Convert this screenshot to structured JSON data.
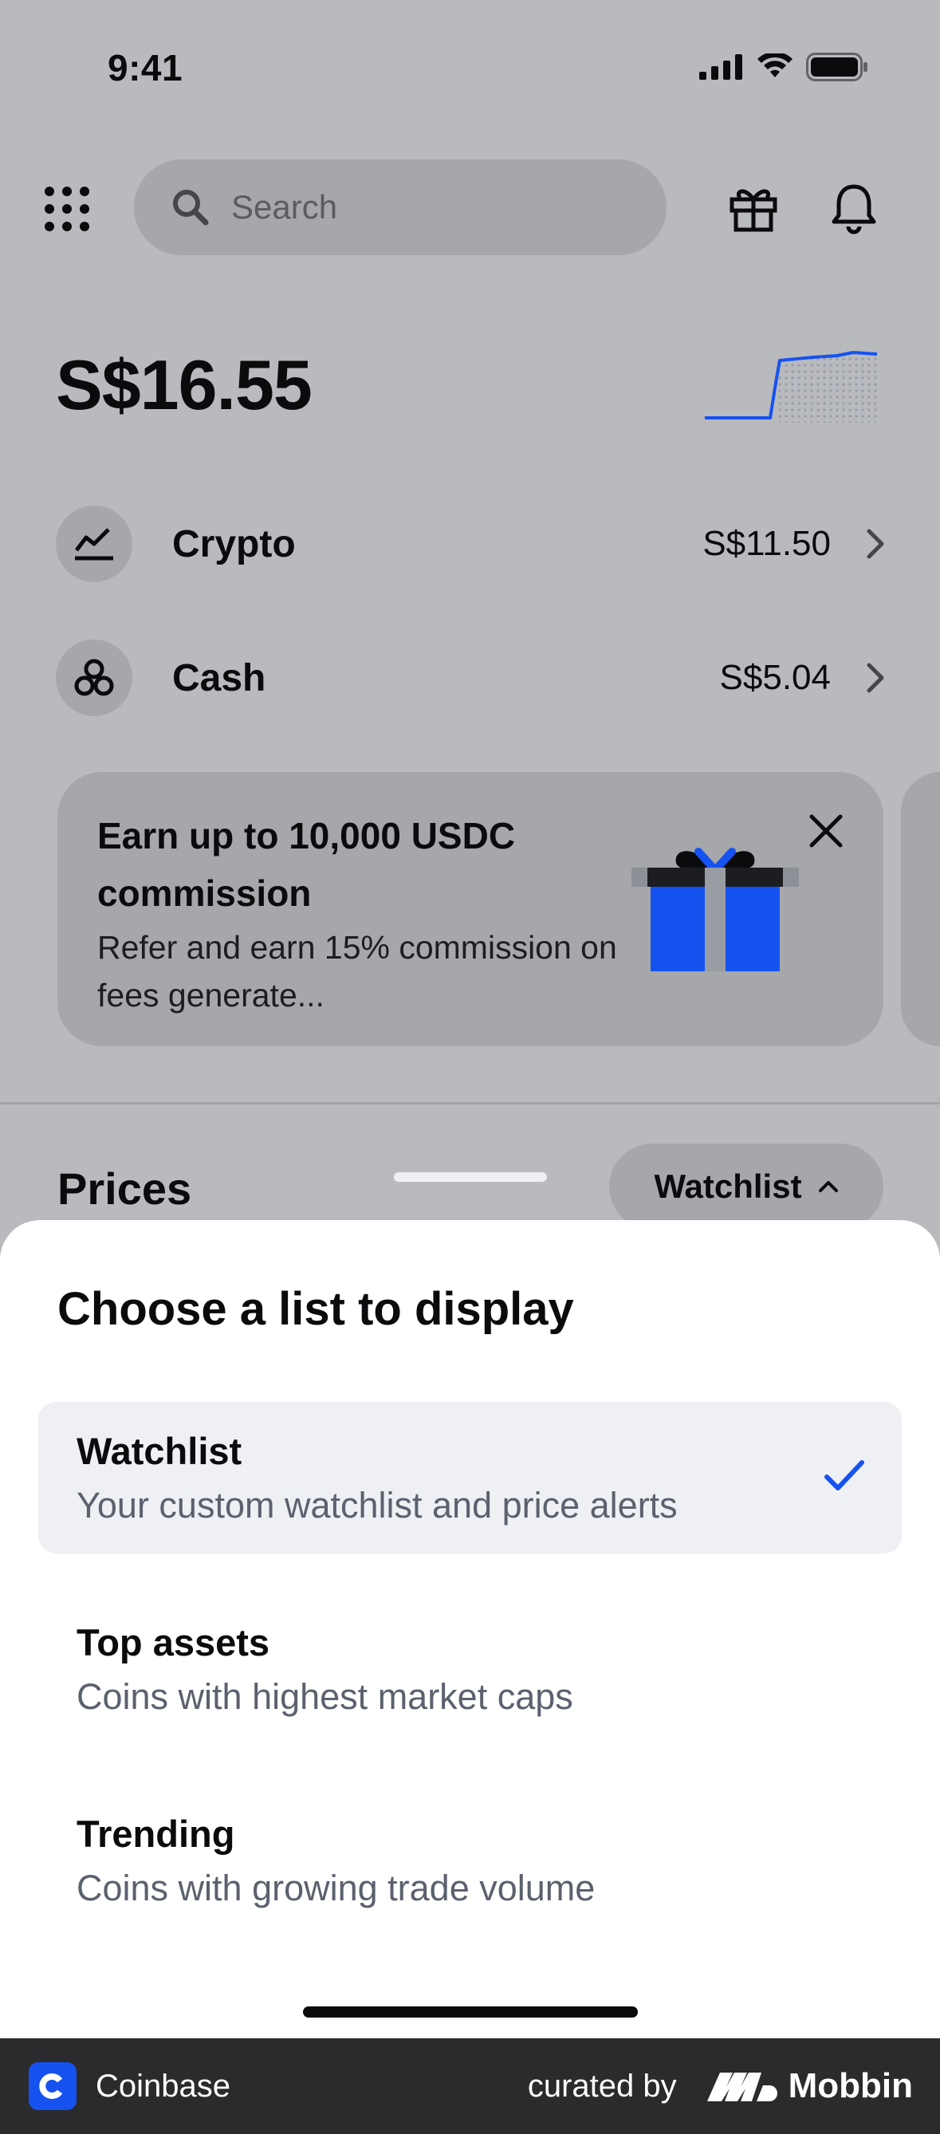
{
  "status_bar": {
    "time": "9:41"
  },
  "header": {
    "search_placeholder": "Search"
  },
  "portfolio": {
    "total": "S$16.55",
    "rows": [
      {
        "label": "Crypto",
        "value": "S$11.50"
      },
      {
        "label": "Cash",
        "value": "S$5.04"
      }
    ]
  },
  "promo": {
    "title": "Earn up to 10,000 USDC commission",
    "body": "Refer and earn 15% commission on fees generate..."
  },
  "prices": {
    "title": "Prices",
    "watchlist_label": "Watchlist"
  },
  "sheet": {
    "title": "Choose a list to display",
    "options": [
      {
        "title": "Watchlist",
        "subtitle": "Your custom watchlist and price alerts",
        "selected": true
      },
      {
        "title": "Top assets",
        "subtitle": "Coins with highest market caps",
        "selected": false
      },
      {
        "title": "Trending",
        "subtitle": "Coins with growing trade volume",
        "selected": false
      }
    ]
  },
  "footer": {
    "app_name": "Coinbase",
    "curated_by": "curated by",
    "brand": "Mobbin"
  },
  "colors": {
    "accent": "#1652f0",
    "sheet_bg": "#ffffff",
    "selected_bg": "#eef0f3",
    "dimmed_bg": "#b9babd"
  }
}
